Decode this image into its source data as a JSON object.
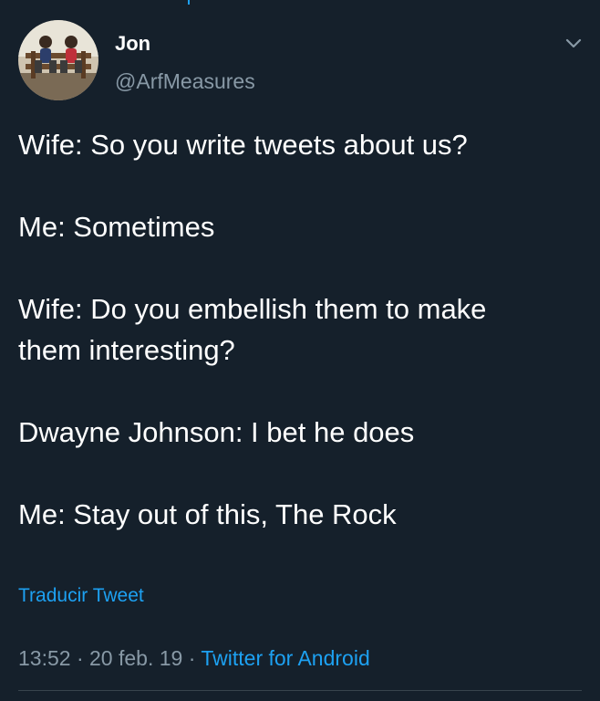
{
  "author": {
    "name": "Jon",
    "handle": "@ArfMeasures"
  },
  "tweet": {
    "lines": [
      "Wife: So you write tweets about us?",
      "Me: Sometimes",
      "Wife: Do you embellish them to make",
      "them interesting?",
      "Dwayne Johnson: I bet he does",
      "Me: Stay out of this, The Rock"
    ]
  },
  "translate_label": "Traducir Tweet",
  "meta": {
    "time": "13:52",
    "separator": "·",
    "date": "20 feb. 19",
    "source": "Twitter for Android"
  },
  "icons": {
    "menu": "chevron-down-icon",
    "avatar": "avatar"
  },
  "colors": {
    "background": "#15202b",
    "text": "#ffffff",
    "muted": "#8899a6",
    "accent": "#1da1f2",
    "divider": "#38444d"
  }
}
